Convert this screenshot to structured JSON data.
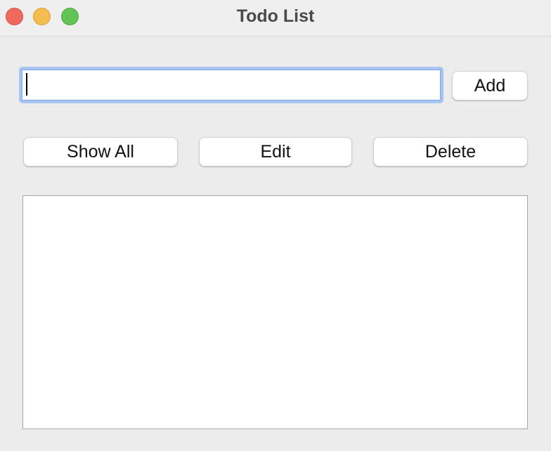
{
  "window": {
    "title": "Todo List"
  },
  "entry": {
    "value": "",
    "placeholder": ""
  },
  "toolbar": {
    "add_label": "Add",
    "show_all_label": "Show All",
    "edit_label": "Edit",
    "delete_label": "Delete"
  },
  "list": {
    "items": []
  },
  "colors": {
    "close": "#ee6a5f",
    "minimize": "#f5bd4f",
    "zoom": "#61c454",
    "focus_ring": "#a7c3f0"
  }
}
